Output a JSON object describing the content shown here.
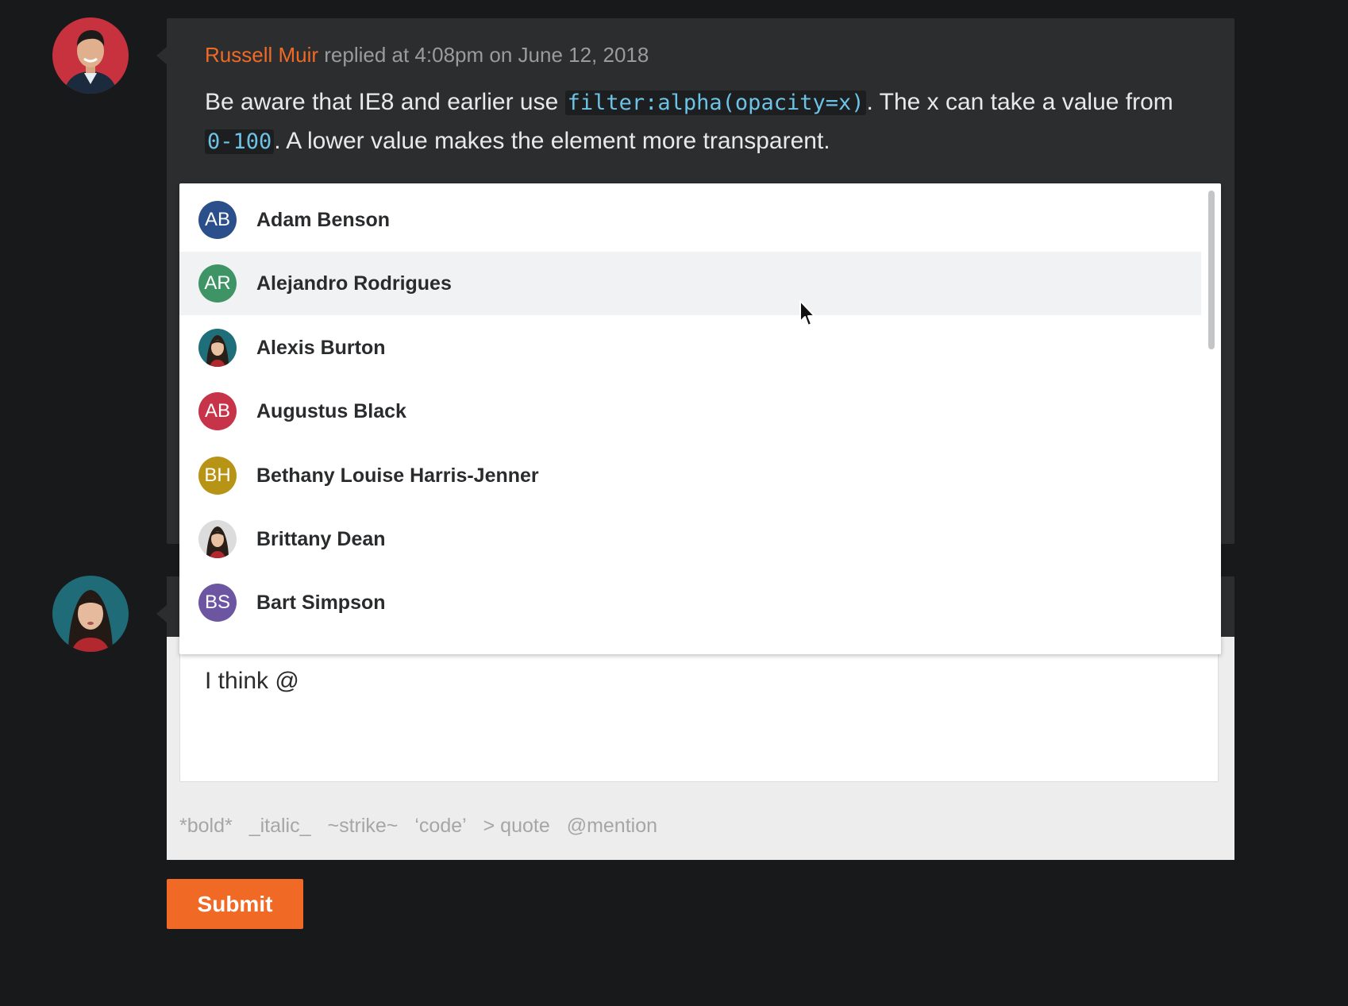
{
  "comment": {
    "author": "Russell Muir",
    "meta": " replied at 4:08pm on June 12, 2018",
    "body_part1": "Be aware that IE8 and earlier use ",
    "code1": "filter:alpha(opacity=x)",
    "body_part2": ". The x can take a value from ",
    "code2": "0-100",
    "body_part3": ". A lower value makes the element more transparent."
  },
  "mention_list": {
    "items": [
      {
        "initials": "AB",
        "name": "Adam Benson",
        "color": "#2b4f8a",
        "photo": false
      },
      {
        "initials": "AR",
        "name": "Alejandro Rodrigues",
        "color": "#3f9466",
        "photo": false
      },
      {
        "initials": "",
        "name": "Alexis Burton",
        "color": "#1e6f7a",
        "photo": true
      },
      {
        "initials": "AB",
        "name": "Augustus Black",
        "color": "#c7344a",
        "photo": false
      },
      {
        "initials": "BH",
        "name": "Bethany Louise Harris-Jenner",
        "color": "#b79316",
        "photo": false
      },
      {
        "initials": "",
        "name": "Brittany Dean",
        "color": "#d9d9d9",
        "photo": true
      },
      {
        "initials": "BS",
        "name": "Bart Simpson",
        "color": "#6d56a1",
        "photo": false
      }
    ],
    "highlighted_index": 1
  },
  "reply": {
    "input_value": "I think @",
    "format_hints": [
      "*bold*",
      "_italic_",
      "~strike~",
      "‘code’",
      "> quote",
      "@mention"
    ]
  },
  "submit_label": "Submit",
  "colors": {
    "accent": "#f06a25",
    "background": "#18191b",
    "card": "#2c2d2f",
    "code": "#6cc3e6"
  }
}
